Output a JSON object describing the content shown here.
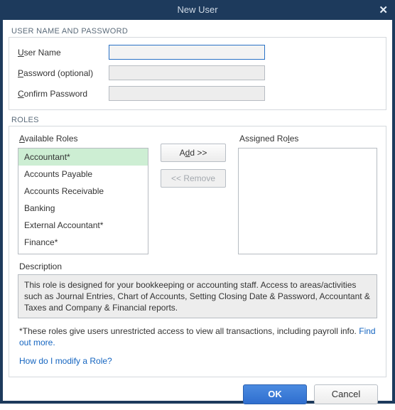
{
  "window": {
    "title": "New User"
  },
  "sections": {
    "credentials_label": "USER NAME AND PASSWORD",
    "roles_label": "ROLES"
  },
  "fields": {
    "username_label_pre": "U",
    "username_label_rest": "ser Name",
    "username_value": "",
    "password_label_pre": "P",
    "password_label_rest": "assword (optional)",
    "password_value": "",
    "confirm_label_pre": "C",
    "confirm_label_rest": "onfirm Password",
    "confirm_value": ""
  },
  "roles": {
    "available_label_pre": "A",
    "available_label_rest": "vailable Roles",
    "assigned_label_pre": "Assigned Ro",
    "assigned_label_ul": "l",
    "assigned_label_post": "es",
    "add_label_pre": "A",
    "add_label_ul": "d",
    "add_label_post": "d >>",
    "remove_label": "<< Remove",
    "available": [
      "Accountant*",
      "Accounts Payable",
      "Accounts Receivable",
      "Banking",
      "External Accountant*",
      "Finance*"
    ],
    "assigned": []
  },
  "description": {
    "label": "Description",
    "text": "This role is designed for your bookkeeping or accounting staff. Access to areas/activities such as Journal Entries, Chart of Accounts, Setting Closing Date & Password, Accountant & Taxes and Company & Financial reports."
  },
  "notes": {
    "asterisk": "*These roles give users unrestricted access to view all transactions, including payroll info.",
    "find_out_more": "Find out more.",
    "modify_link": "How do I modify a Role?"
  },
  "buttons": {
    "ok": "OK",
    "cancel": "Cancel"
  }
}
